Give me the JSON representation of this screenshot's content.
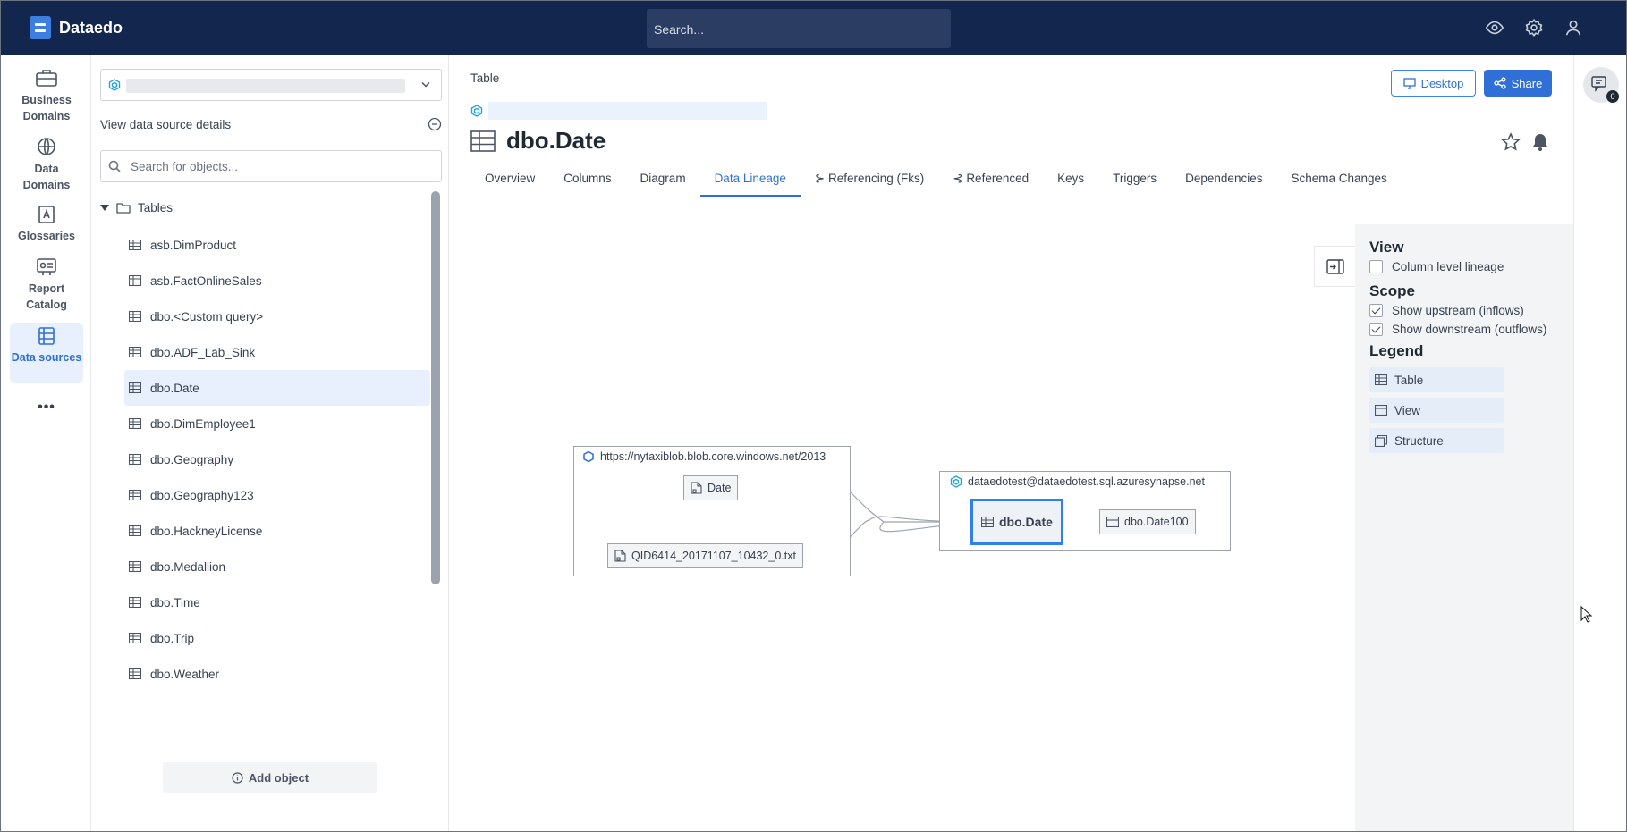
{
  "app": {
    "name": "Dataedo"
  },
  "header": {
    "search_placeholder": "Search..."
  },
  "rail": {
    "items": [
      {
        "label": "Business Domains"
      },
      {
        "label": "Data Domains"
      },
      {
        "label": "Glossaries"
      },
      {
        "label": "Report Catalog"
      },
      {
        "label": "Data sources"
      }
    ],
    "more": "•••"
  },
  "objects": {
    "view_details": "View data source details",
    "search_placeholder": "Search for objects...",
    "folder": "Tables",
    "items": [
      "asb.DimProduct",
      "asb.FactOnlineSales",
      "dbo.<Custom query>",
      "dbo.ADF_Lab_Sink",
      "dbo.Date",
      "dbo.DimEmployee1",
      "dbo.Geography",
      "dbo.Geography123",
      "dbo.HackneyLicense",
      "dbo.Medallion",
      "dbo.Time",
      "dbo.Trip",
      "dbo.Weather"
    ],
    "selected": "dbo.Date",
    "add_object": "Add object"
  },
  "main": {
    "object_type": "Table",
    "title": "dbo.Date",
    "buttons": {
      "desktop": "Desktop",
      "share": "Share"
    },
    "tabs": [
      "Overview",
      "Columns",
      "Diagram",
      "Data Lineage",
      "Referencing (Fks)",
      "Referenced",
      "Keys",
      "Triggers",
      "Dependencies",
      "Schema Changes"
    ],
    "active_tab": "Data Lineage"
  },
  "lineage": {
    "source_container": "https://nytaxiblob.blob.core.windows.net/2013",
    "source_nodes": [
      "Date",
      "QID6414_20171107_10432_0.txt"
    ],
    "target_container": "dataedotest@dataedotest.sql.azuresynapse.net",
    "main_node": "dbo.Date",
    "downstream_node": "dbo.Date100"
  },
  "side_panel": {
    "view_heading": "View",
    "column_level": "Column level lineage",
    "column_level_checked": false,
    "scope_heading": "Scope",
    "upstream": "Show upstream (inflows)",
    "upstream_checked": true,
    "downstream": "Show downstream (outflows)",
    "downstream_checked": true,
    "legend_heading": "Legend",
    "legend": [
      "Table",
      "View",
      "Structure"
    ]
  },
  "comments": {
    "count": "0"
  },
  "colors": {
    "header_bg": "#13264d",
    "accent": "#2f6fd6",
    "selected_bg": "#e8f0fd"
  }
}
